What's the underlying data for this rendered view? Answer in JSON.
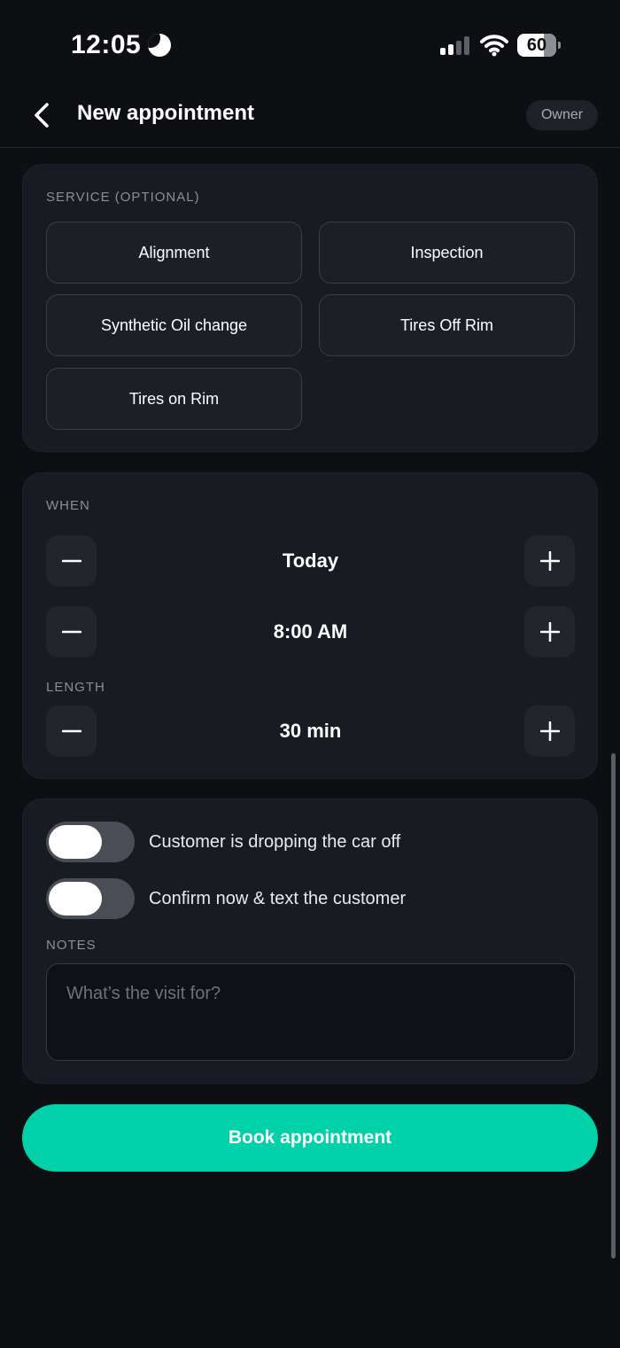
{
  "status_bar": {
    "time": "12:05",
    "battery": "60"
  },
  "header": {
    "title": "New appointment",
    "role_badge": "Owner"
  },
  "service": {
    "label": "SERVICE (OPTIONAL)",
    "options": [
      "Alignment",
      "Inspection",
      "Synthetic Oil change",
      "Tires Off Rim",
      "Tires on Rim"
    ]
  },
  "when": {
    "label": "WHEN",
    "day": "Today",
    "time": "8:00 AM"
  },
  "length": {
    "label": "LENGTH",
    "value": "30 min"
  },
  "options": {
    "drop_off_label": "Customer is dropping the car off",
    "drop_off_on": false,
    "confirm_label": "Confirm now & text the customer",
    "confirm_on": false
  },
  "notes": {
    "label": "NOTES",
    "value": "",
    "placeholder": "What’s the visit for?"
  },
  "actions": {
    "book_label": "Book appointment"
  },
  "colors": {
    "accent": "#00d1a8",
    "background": "#0d0f13",
    "card": "#181b21"
  }
}
